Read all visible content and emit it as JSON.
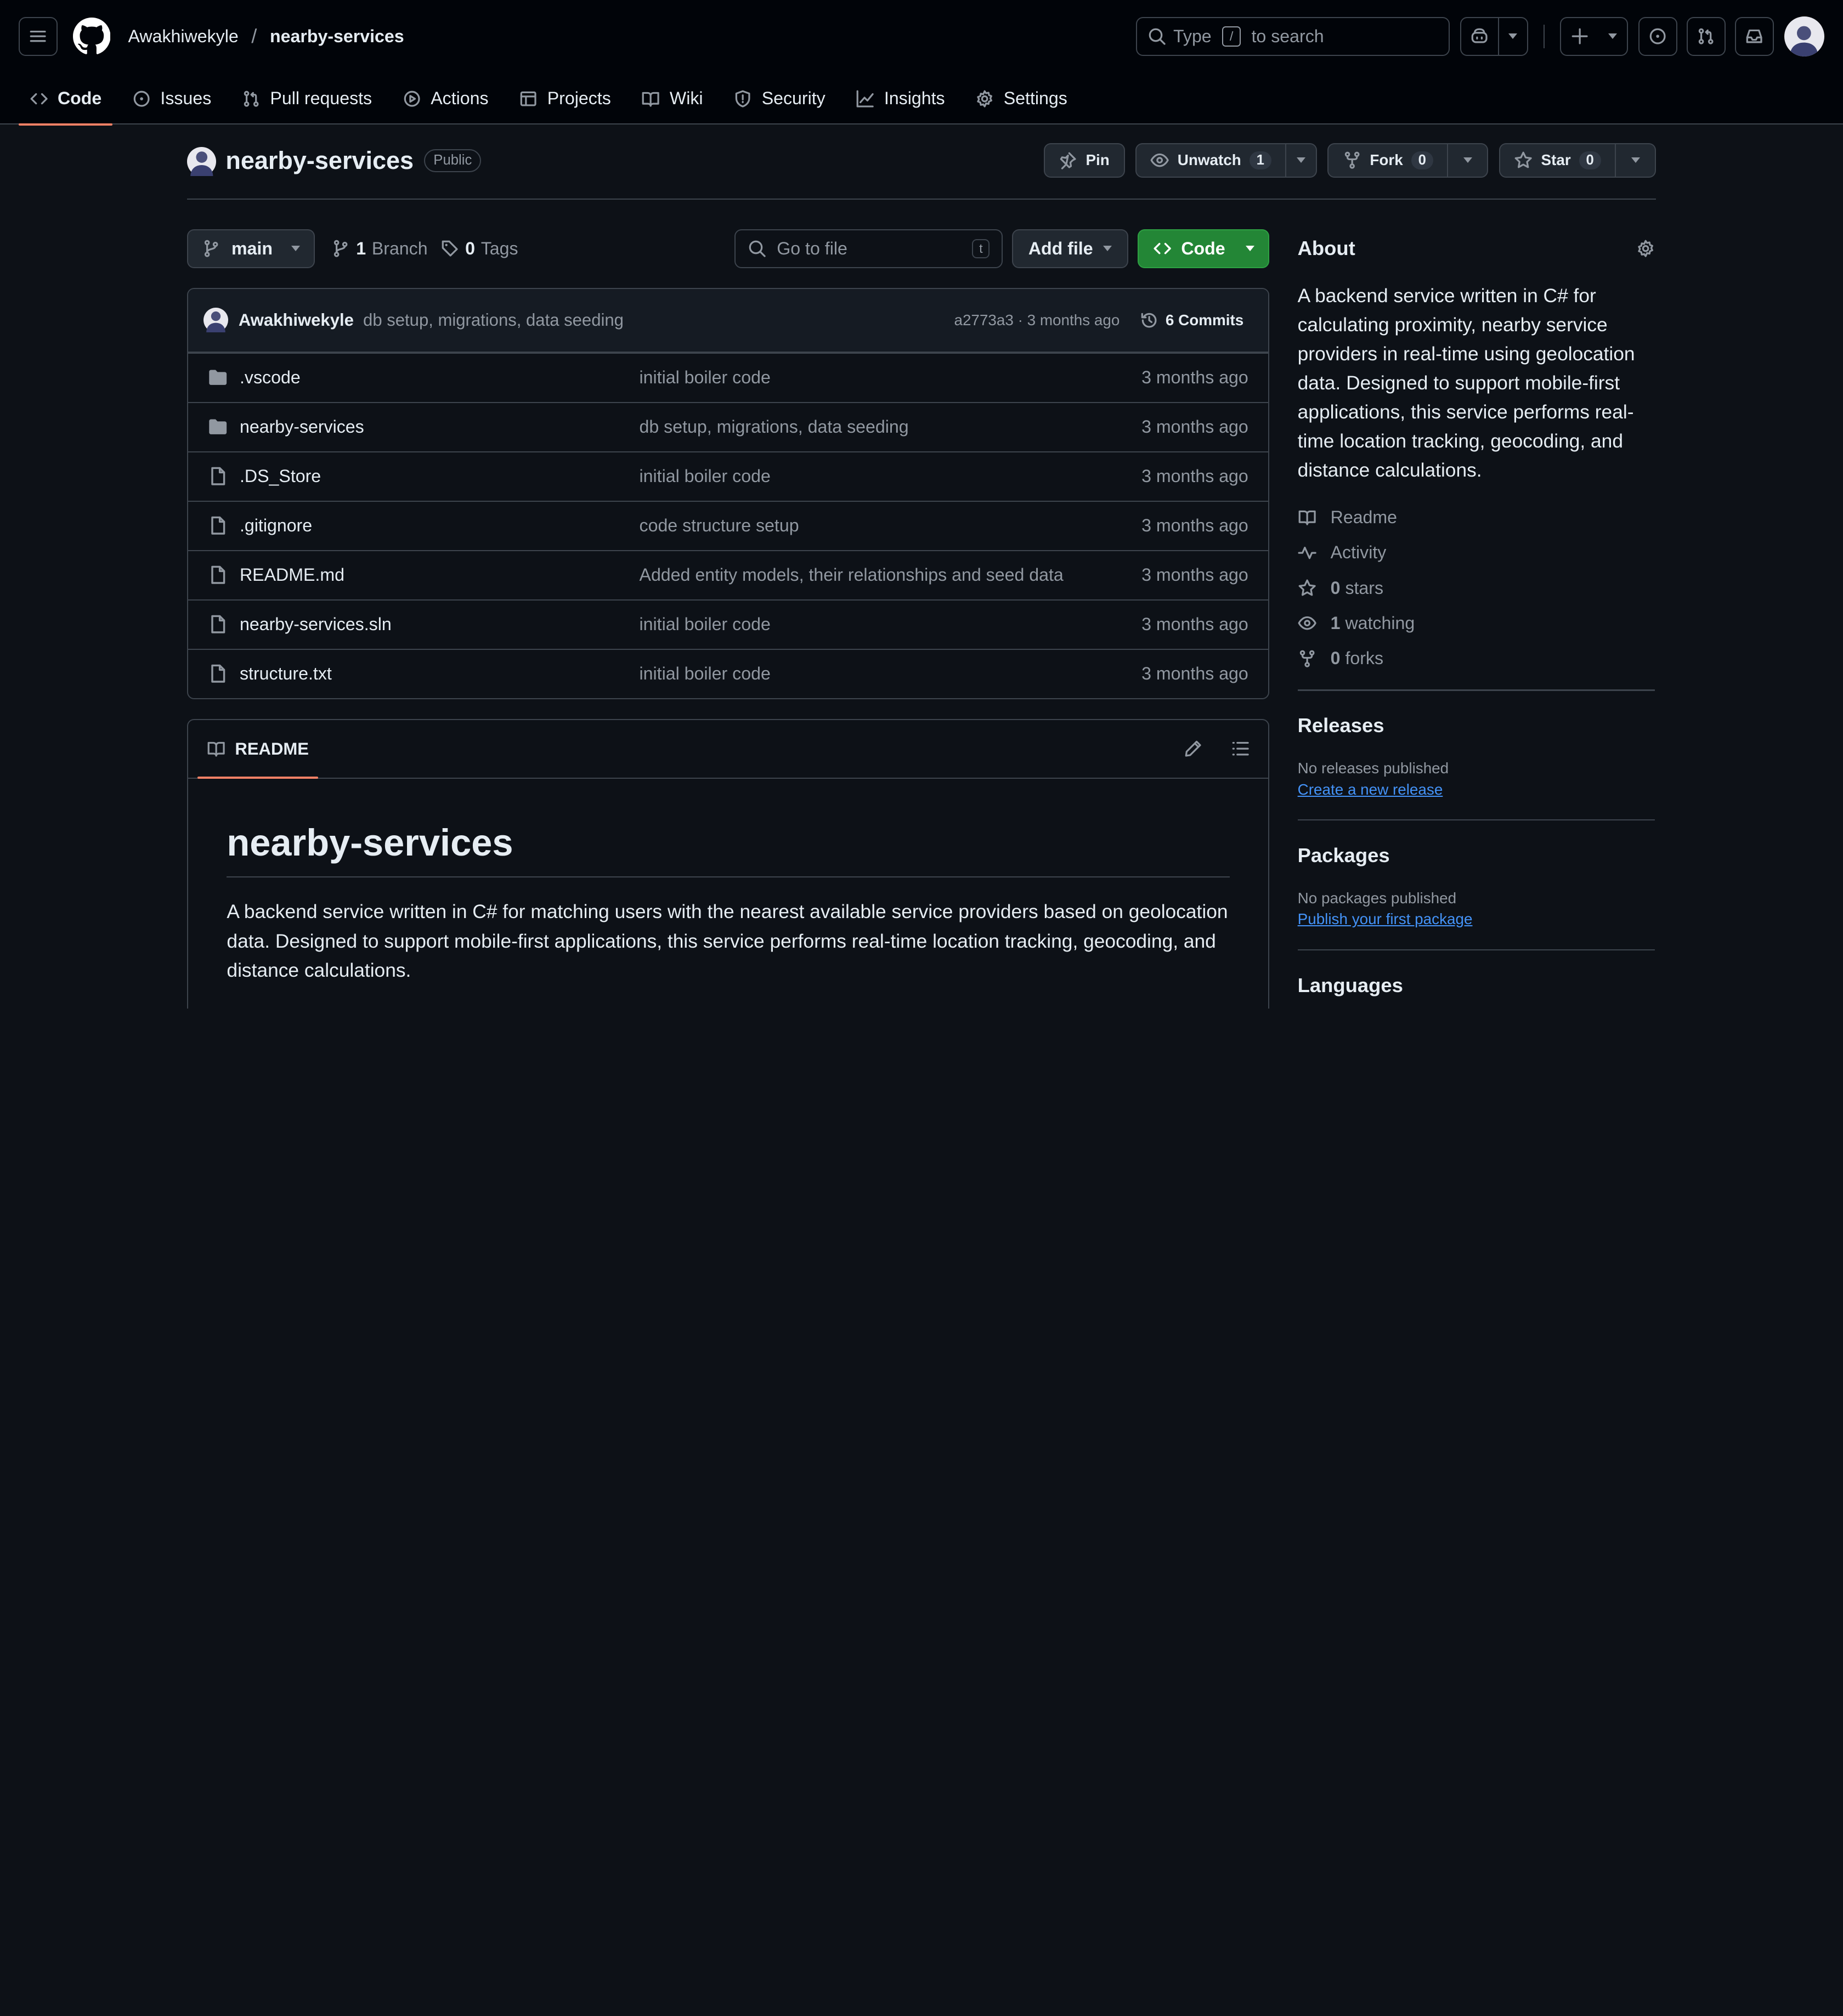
{
  "header": {
    "owner": "Awakhiwekyle",
    "separator": "/",
    "repo": "nearby-services",
    "search": {
      "before": "Type",
      "key": "/",
      "after": "to search"
    }
  },
  "tabs": [
    {
      "label": "Code",
      "icon": "code-icon",
      "active": true
    },
    {
      "label": "Issues",
      "icon": "issue-icon"
    },
    {
      "label": "Pull requests",
      "icon": "pull-request-icon"
    },
    {
      "label": "Actions",
      "icon": "play-icon"
    },
    {
      "label": "Projects",
      "icon": "table-icon"
    },
    {
      "label": "Wiki",
      "icon": "book-icon"
    },
    {
      "label": "Security",
      "icon": "shield-icon"
    },
    {
      "label": "Insights",
      "icon": "graph-icon"
    },
    {
      "label": "Settings",
      "icon": "gear-icon"
    }
  ],
  "repo": {
    "name": "nearby-services",
    "visibility": "Public",
    "pin": "Pin",
    "unwatch": "Unwatch",
    "watch_count": "1",
    "fork": "Fork",
    "fork_count": "0",
    "star": "Star",
    "star_count": "0"
  },
  "controls": {
    "branch": "main",
    "branch_count": "1",
    "branch_label": "Branch",
    "tag_count": "0",
    "tag_label": "Tags",
    "goto_placeholder": "Go to file",
    "goto_key": "t",
    "add_file": "Add file",
    "code": "Code"
  },
  "commit": {
    "author": "Awakhiwekyle",
    "message": "db setup, migrations, data seeding",
    "meta": "a2773a3 · 3 months ago",
    "commits": "6 Commits"
  },
  "files": [
    {
      "type": "folder",
      "name": ".vscode",
      "message": "initial boiler code",
      "time": "3 months ago"
    },
    {
      "type": "folder",
      "name": "nearby-services",
      "message": "db setup, migrations, data seeding",
      "time": "3 months ago"
    },
    {
      "type": "file",
      "name": ".DS_Store",
      "message": "initial boiler code",
      "time": "3 months ago"
    },
    {
      "type": "file",
      "name": ".gitignore",
      "message": "code structure setup",
      "time": "3 months ago"
    },
    {
      "type": "file",
      "name": "README.md",
      "message": "Added entity models, their relationships and seed data",
      "time": "3 months ago"
    },
    {
      "type": "file",
      "name": "nearby-services.sln",
      "message": "initial boiler code",
      "time": "3 months ago"
    },
    {
      "type": "file",
      "name": "structure.txt",
      "message": "initial boiler code",
      "time": "3 months ago"
    }
  ],
  "readme": {
    "tab": "README",
    "title": "nearby-services",
    "body": "A backend service written in C# for matching users with the nearest available service providers based on geolocation data. Designed to support mobile-first applications, this service performs real-time location tracking, geocoding, and distance calculations."
  },
  "about": {
    "title": "About",
    "description": "A backend service written in C# for calculating proximity, nearby service providers in real-time using geolocation data. Designed to support mobile-first applications, this service performs real-time location tracking, geocoding, and distance calculations.",
    "readme": "Readme",
    "activity": "Activity",
    "stars_count": "0",
    "stars_label": "stars",
    "watching_count": "1",
    "watching_label": "watching",
    "forks_count": "0",
    "forks_label": "forks"
  },
  "releases": {
    "title": "Releases",
    "empty": "No releases published",
    "link": "Create a new release"
  },
  "packages": {
    "title": "Packages",
    "empty": "No packages published",
    "link": "Publish your first package"
  },
  "languages": {
    "title": "Languages"
  },
  "colors": {
    "accent": "#f78166",
    "code_button": "#238636",
    "link": "#4493f8",
    "background": "#0d1117"
  }
}
